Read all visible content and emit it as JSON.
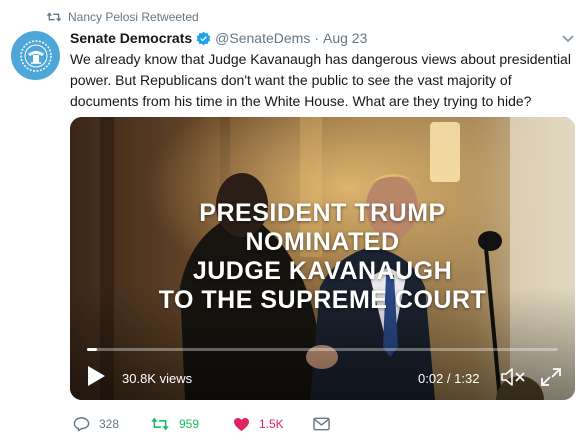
{
  "retweet_context": {
    "text": "Nancy Pelosi Retweeted",
    "icon": "retweet-icon"
  },
  "tweet": {
    "author_name": "Senate Democrats",
    "handle": "@SenateDems",
    "separator": "·",
    "date": "Aug 23",
    "verified": true,
    "text": "We already know that Judge Kavanaugh has dangerous views about presidential power. But Republicans don't want the public to see the vast majority of documents from his time in the White House. What are they trying to hide?"
  },
  "video": {
    "overlay_lines": [
      "PRESIDENT TRUMP",
      "NOMINATED",
      "JUDGE KAVANAUGH",
      "TO THE SUPREME COURT"
    ],
    "views": "30.8K views",
    "time": "0:02 / 1:32",
    "progress_fraction": 0.022
  },
  "actions": {
    "replies": "328",
    "retweets": "959",
    "likes": "1.5K"
  },
  "colors": {
    "text": "#14171a",
    "muted": "#657786",
    "retweet_active": "#17bf63",
    "like_active": "#e0245e",
    "avatar_bg": "#4fa6d9"
  }
}
